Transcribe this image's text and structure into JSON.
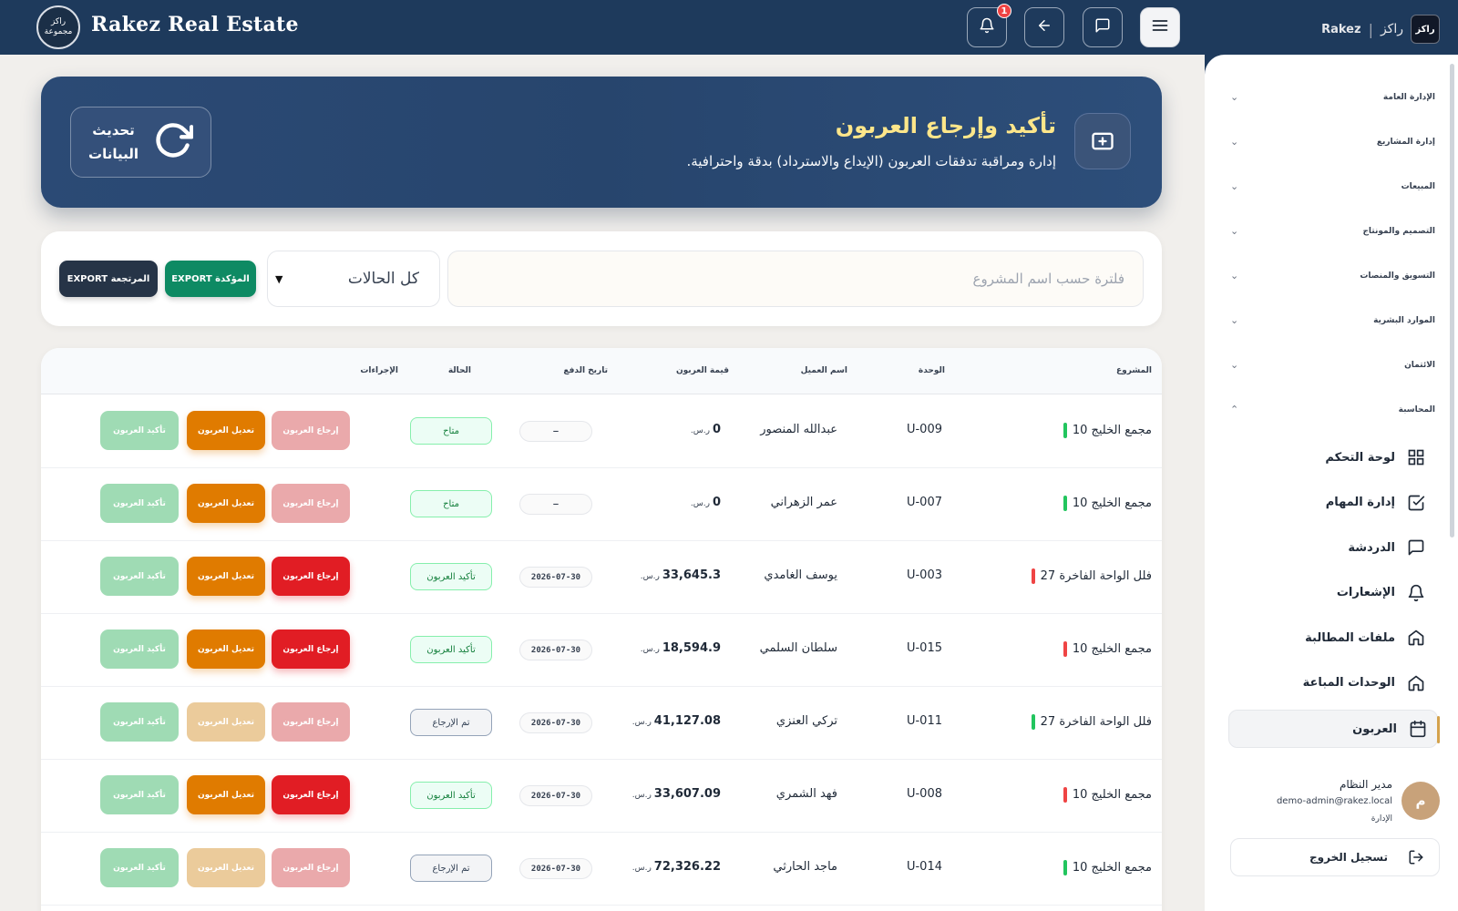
{
  "topbar": {
    "brand_name": "Rakez Real Estate",
    "logo_line1": "راكز",
    "logo_line2": "مجموعة",
    "notification_count": "1"
  },
  "hero": {
    "title": "تأكيد وإرجاع العربون",
    "subtitle": "إدارة ومراقبة تدفقات العربون (الإيداع والاسترداد) بدقة واحترافية.",
    "refresh_line1": "تحديث",
    "refresh_line2": "البيانات"
  },
  "filters": {
    "search_placeholder": "فلترة حسب اسم المشروع",
    "search_value": "",
    "status_selected": "كل الحالات",
    "export_confirmed": "EXPORT المؤكدة",
    "export_refunded": "EXPORT المرتجعة"
  },
  "table": {
    "headers": {
      "project": "المشروع",
      "unit": "الوحدة",
      "client": "اسم العميل",
      "amount": "قيمة العربون",
      "date": "تاريخ الدفع",
      "status": "الحالة",
      "actions": "الإجراءات"
    },
    "action_labels": {
      "refund": "إرجاع العربون",
      "edit": "تعديل العربون",
      "confirm": "تأكيد العربون"
    },
    "currency": "ر.س.",
    "rows": [
      {
        "project": "مجمع الخليج 10",
        "project_color": "#22c55e",
        "unit": "U-009",
        "client": "عبدالله المنصور",
        "amount": "0",
        "date": "—",
        "status": "متاح",
        "status_kind": "available"
      },
      {
        "project": "مجمع الخليج 10",
        "project_color": "#22c55e",
        "unit": "U-007",
        "client": "عمر الزهراني",
        "amount": "0",
        "date": "—",
        "status": "متاح",
        "status_kind": "available"
      },
      {
        "project": "فلل الواحة الفاخرة 27",
        "project_color": "#ef4444",
        "unit": "U-003",
        "client": "يوسف الغامدي",
        "amount": "33,645.3",
        "date": "2026-07-30",
        "status": "تأكيد العربون",
        "status_kind": "confirmed"
      },
      {
        "project": "مجمع الخليج 10",
        "project_color": "#ef4444",
        "unit": "U-015",
        "client": "سلطان السلمي",
        "amount": "18,594.9",
        "date": "2026-07-30",
        "status": "تأكيد العربون",
        "status_kind": "confirmed"
      },
      {
        "project": "فلل الواحة الفاخرة 27",
        "project_color": "#22c55e",
        "unit": "U-011",
        "client": "تركي العنزي",
        "amount": "41,127.08",
        "date": "2026-07-30",
        "status": "تم الإرجاع",
        "status_kind": "refunded"
      },
      {
        "project": "مجمع الخليج 10",
        "project_color": "#ef4444",
        "unit": "U-008",
        "client": "فهد الشمري",
        "amount": "33,607.09",
        "date": "2026-07-30",
        "status": "تأكيد العربون",
        "status_kind": "confirmed"
      },
      {
        "project": "مجمع الخليج 10",
        "project_color": "#22c55e",
        "unit": "U-014",
        "client": "ماجد الحارثي",
        "amount": "72,326.22",
        "date": "2026-07-30",
        "status": "تم الإرجاع",
        "status_kind": "refunded"
      }
    ]
  },
  "sidebar": {
    "brand_ar": "راكز",
    "brand_en": "Rakez",
    "brand_mark": "راكز",
    "sections": [
      {
        "label": "الإدارة العامة",
        "expanded": false
      },
      {
        "label": "إدارة المشاريع",
        "expanded": false
      },
      {
        "label": "المبيعات",
        "expanded": false
      },
      {
        "label": "التصميم والمونتاج",
        "expanded": false
      },
      {
        "label": "التسويق والمنصات",
        "expanded": false
      },
      {
        "label": "الموارد البشرية",
        "expanded": false
      },
      {
        "label": "الائتمان",
        "expanded": false
      },
      {
        "label": "المحاسبة",
        "expanded": true
      }
    ],
    "nav_items": [
      {
        "label": "لوحة التحكم",
        "icon": "grid-icon"
      },
      {
        "label": "إدارة المهام",
        "icon": "checkbox-icon"
      },
      {
        "label": "الدردشة",
        "icon": "chat-icon"
      },
      {
        "label": "الإشعارات",
        "icon": "bell-icon"
      },
      {
        "label": "ملفات المطالبة",
        "icon": "home-icon"
      },
      {
        "label": "الوحدات المباعة",
        "icon": "home-icon"
      },
      {
        "label": "العربون",
        "icon": "calendar-icon",
        "active": true
      }
    ],
    "user": {
      "avatar_initial": "م",
      "name": "مدير النظام",
      "email": "demo-admin@rakez.local",
      "role": "الإدارة"
    },
    "logout_label": "تسجيل الخروج"
  }
}
